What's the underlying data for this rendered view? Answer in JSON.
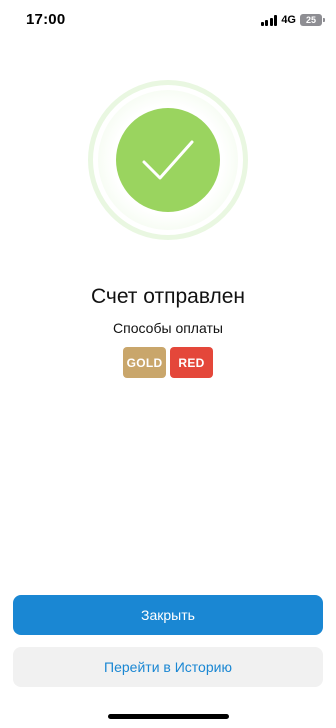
{
  "status_bar": {
    "time": "17:00",
    "network": "4G",
    "battery": "25"
  },
  "icons": {
    "signal": "cellular-signal-icon",
    "battery": "battery-icon",
    "success": "checkmark-icon"
  },
  "colors": {
    "success_green": "#9ad45f",
    "ring_green": "#e9f7e1",
    "gold": "#c9a66b",
    "red": "#e4473a",
    "primary_blue": "#1a87d3",
    "secondary_bg": "#f1f1f1"
  },
  "main": {
    "title": "Счет отправлен",
    "subtitle": "Способы оплаты",
    "badges": [
      {
        "label": "GOLD"
      },
      {
        "label": "RED"
      }
    ]
  },
  "actions": {
    "close_label": "Закрыть",
    "history_label": "Перейти в Историю"
  }
}
